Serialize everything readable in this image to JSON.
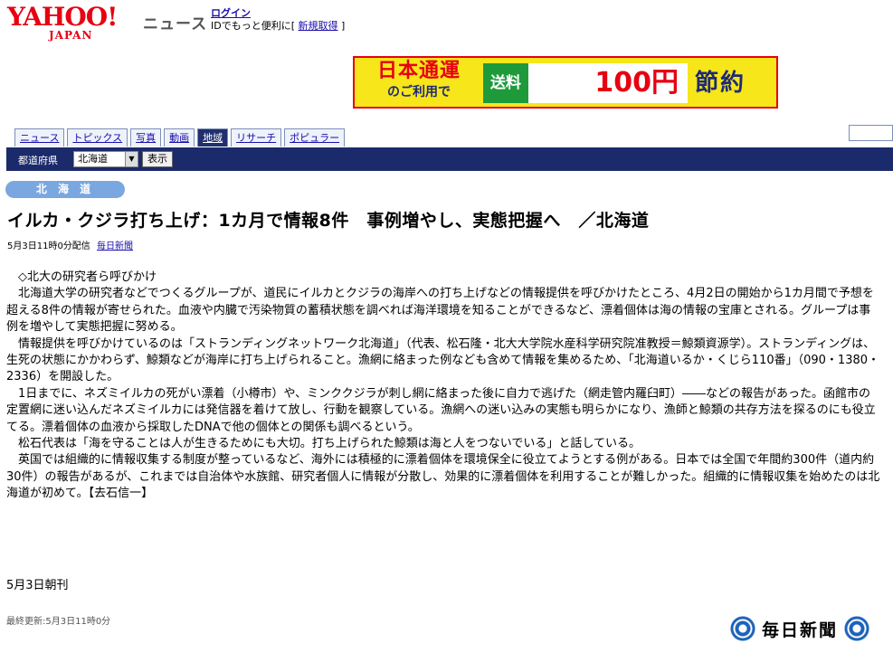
{
  "header": {
    "logo_main": "YAHOO!",
    "logo_sub": "JAPAN",
    "section_title": "ニュース",
    "login_link": "ログイン",
    "id_line_prefix": "IDでもっと便利に[",
    "new_signup_link": "新規取得",
    "id_line_suffix": "]"
  },
  "banner": {
    "line1": "日本通運",
    "line2": "のご利用で",
    "green_label": "送料",
    "amount": "100円",
    "right_label": "節約",
    "colors": {
      "background": "#f6e61a",
      "border": "#e60012",
      "green": "#1f9a3b"
    }
  },
  "tabs": [
    {
      "label": "ニュース",
      "active": false
    },
    {
      "label": "トピックス",
      "active": false
    },
    {
      "label": "写真",
      "active": false
    },
    {
      "label": "動画",
      "active": false
    },
    {
      "label": "地域",
      "active": true
    },
    {
      "label": "リサーチ",
      "active": false
    },
    {
      "label": "ポピュラー",
      "active": false
    }
  ],
  "navbar": {
    "pref_label": "都道府県",
    "pref_value": "北海道",
    "show_button": "表示"
  },
  "region_badge": "北 海 道",
  "article": {
    "headline": "イルカ・クジラ打ち上げ：1カ月で情報8件　事例増やし、実態把握へ　／北海道",
    "date": "5月3日11時0分配信",
    "source_link": "毎日新聞",
    "paragraphs": [
      "　◇北大の研究者ら呼びかけ",
      "　北海道大学の研究者などでつくるグループが、道民にイルカとクジラの海岸への打ち上げなどの情報提供を呼びかけたところ、4月2日の開始から1カ月間で予想を超える8件の情報が寄せられた。血液や内臓で汚染物質の蓄積状態を調べれば海洋環境を知ることができるなど、漂着個体は海の情報の宝庫とされる。グループは事例を増やして実態把握に努める。",
      "　情報提供を呼びかけているのは「ストランディングネットワーク北海道」（代表、松石隆・北大大学院水産科学研究院准教授＝鯨類資源学）。ストランディングは、生死の状態にかかわらず、鯨類などが海岸に打ち上げられること。漁網に絡まった例なども含めて情報を集めるため、「北海道いるか・くじら110番」（090・1380・2336）を開設した。",
      "　1日までに、ネズミイルカの死がい漂着（小樽市）や、ミンククジラが刺し網に絡まった後に自力で逃げた（網走管内羅臼町）――などの報告があった。函館市の定置網に迷い込んだネズミイルカには発信器を着けて放し、行動を観察している。漁網への迷い込みの実態も明らかになり、漁師と鯨類の共存方法を探るのにも役立てる。漂着個体の血液から採取したDNAで他の個体との関係も調べるという。",
      "　松石代表は「海を守ることは人が生きるためにも大切。打ち上げられた鯨類は海と人をつないでいる」と話している。",
      "　英国では組織的に情報収集する制度が整っているなど、海外には積極的に漂着個体を環境保全に役立てようとする例がある。日本では全国で年間約300件（道内約30件）の報告があるが、これまでは自治体や水族館、研究者個人に情報が分散し、効果的に漂着個体を利用することが難しかった。組織的に情報収集を始めたのは北海道が初めて。【去石信一】"
    ],
    "edition": "5月3日朝刊",
    "last_updated": "最終更新:5月3日11時0分"
  },
  "footer_logo": "毎日新聞",
  "colors": {
    "brand_red": "#e60012",
    "navbar": "#1b2a6b",
    "badge": "#7aa7e0",
    "link": "#1a0dab"
  }
}
